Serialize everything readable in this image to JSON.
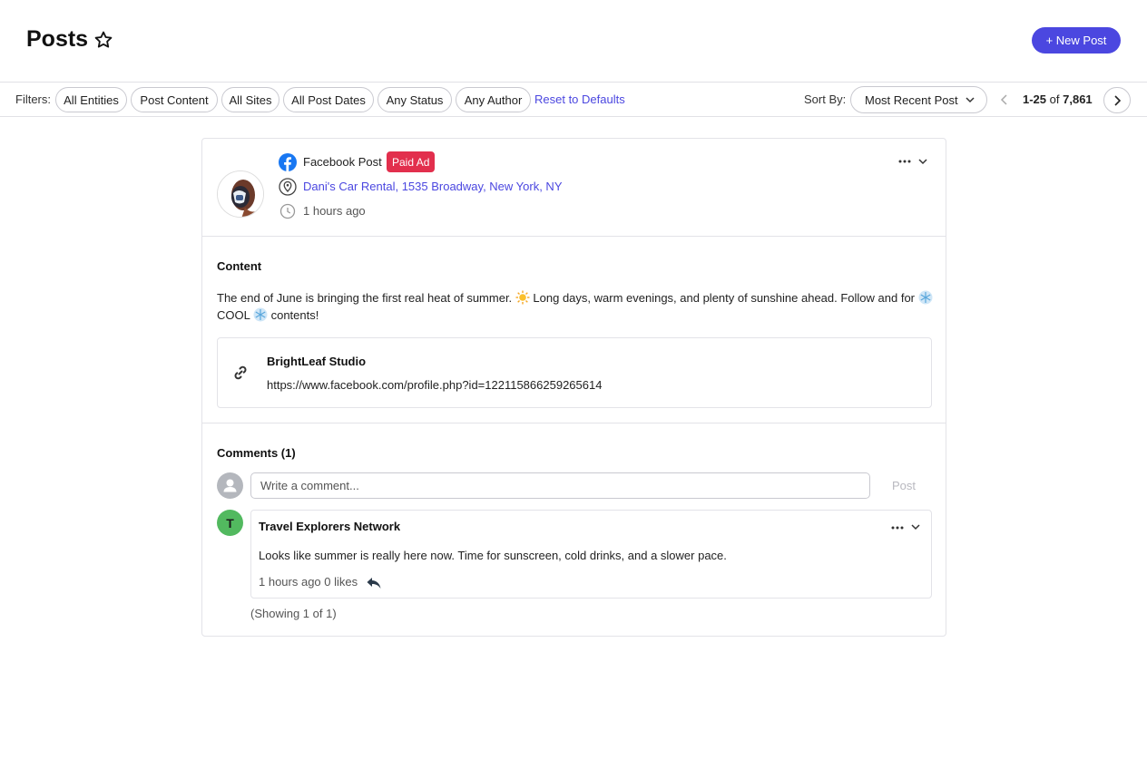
{
  "header": {
    "title": "Posts",
    "new_post_label": "+ New Post"
  },
  "filters": {
    "label": "Filters:",
    "chips": [
      "All Entities",
      "Post Content",
      "All Sites",
      "All Post Dates",
      "Any Status",
      "Any Author"
    ],
    "reset_label": "Reset to Defaults"
  },
  "sort": {
    "label": "Sort By:",
    "selected": "Most Recent Post"
  },
  "pager": {
    "range": "1-25",
    "of": "of",
    "total": "7,861"
  },
  "post": {
    "type": "Facebook Post",
    "badge": "Paid Ad",
    "location": "Dani's Car Rental, 1535 Broadway, New York, NY",
    "time": "1 hours ago",
    "content_title": "Content",
    "content_part1": "The end of June is bringing the first real heat of summer.",
    "content_part2": " Long days, warm evenings, and plenty of sunshine ahead. Follow and for ",
    "content_part3": " COOL ",
    "content_part4": " contents!",
    "link": {
      "title": "BrightLeaf Studio",
      "url": "https://www.facebook.com/profile.php?id=122115866259265614"
    }
  },
  "comments": {
    "title": "Comments (1)",
    "input_placeholder": "Write a comment...",
    "post_label": "Post",
    "items": [
      {
        "initial": "T",
        "author": "Travel Explorers Network",
        "text": "Looks like summer is really here now. Time for sunscreen, cold drinks, and a slower pace.",
        "meta": "1 hours ago 0 likes"
      }
    ],
    "showing": "(Showing 1 of 1)"
  },
  "colors": {
    "accent": "#4b47e0",
    "badge_red": "#e22f4d",
    "commenter_green": "#52b95f",
    "facebook_blue": "#1877f2"
  }
}
